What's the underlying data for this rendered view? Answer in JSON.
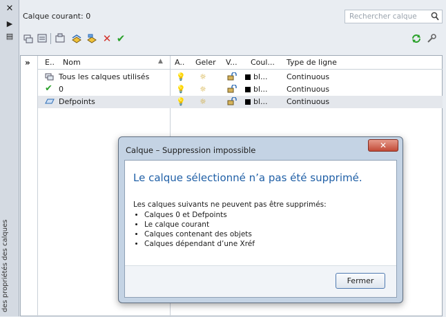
{
  "palette": {
    "accent": "#1f5fa6",
    "check": "#2aa12a",
    "red_x": "#d2312a",
    "dialog_bg": "#c4d3e4"
  },
  "sidebar": {
    "close_icon": "close-icon",
    "pin_icon": "pin-icon",
    "props_icon": "properties-icon",
    "title": "des propriétés des calques"
  },
  "top": {
    "current_layer": "Calque courant: 0",
    "search_placeholder": "Rechercher calque"
  },
  "toolbar": {
    "icons": [
      "new-property-filter-icon",
      "new-group-filter-icon",
      "layer-states-icon",
      "new-layer-icon",
      "new-layer-vp-frozen-icon",
      "delete-layer-icon",
      "set-current-icon",
      "refresh-icon",
      "settings-icon"
    ]
  },
  "tree": {
    "col_e": "E..",
    "col_name": "Nom",
    "items": [
      {
        "label": "Tous les calques utilisés",
        "selected": false
      },
      {
        "label": "0",
        "selected": false
      },
      {
        "label": "Defpoints",
        "selected": true
      }
    ]
  },
  "list": {
    "headers": {
      "a": "A..",
      "geler": "Geler",
      "v": "V...",
      "coul": "Coul...",
      "type": "Type de ligne"
    },
    "rows": [
      {
        "color": "bl...",
        "linetype": "Continuous"
      },
      {
        "color": "bl...",
        "linetype": "Continuous"
      },
      {
        "color": "bl...",
        "linetype": "Continuous"
      }
    ]
  },
  "dialog": {
    "title": "Calque – Suppression impossible",
    "heading": "Le calque sélectionné n’a pas été supprimé.",
    "intro": "Les calques suivants ne peuvent pas être supprimés:",
    "bullets": [
      "Calques 0 et Defpoints",
      "Le calque courant",
      "Calques contenant des objets",
      "Calques dépendant d’une Xréf"
    ],
    "button": "Fermer"
  }
}
